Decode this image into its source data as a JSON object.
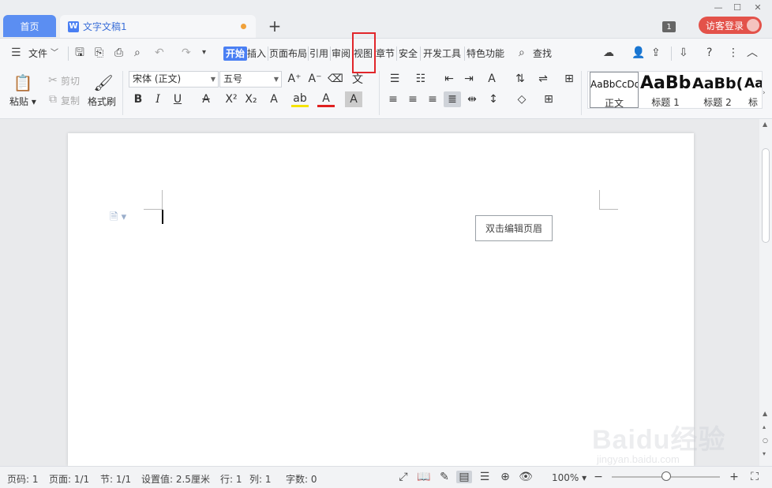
{
  "tabs": {
    "home": "首页",
    "doc_title": "文字文稿1",
    "add": "+"
  },
  "titlebar": {
    "badge": "1",
    "login": "访客登录"
  },
  "menu": {
    "file": "文件",
    "items": [
      "开始",
      "插入",
      "页面布局",
      "引用",
      "审阅",
      "视图",
      "章节",
      "安全",
      "开发工具",
      "特色功能"
    ],
    "search": "查找"
  },
  "ribbon": {
    "paste": "粘贴",
    "cut": "剪切",
    "copy": "复制",
    "format_painter": "格式刷",
    "font_name": "宋体 (正文)",
    "font_size": "五号"
  },
  "styles": [
    {
      "sample": "AaBbCcDd",
      "label": "正文"
    },
    {
      "sample": "AaBb",
      "label": "标题 1"
    },
    {
      "sample": "AaBb(",
      "label": "标题 2"
    },
    {
      "sample": "Aa",
      "label": "标"
    }
  ],
  "document": {
    "header_hint": "双击编辑页眉"
  },
  "status": {
    "page_num": "页码: 1",
    "pages": "页面: 1/1",
    "section": "节: 1/1",
    "setting": "设置值: 2.5厘米",
    "row": "行: 1",
    "col": "列: 1",
    "words": "字数: 0",
    "zoom": "100%"
  },
  "zoom_level": 1.0,
  "watermark": {
    "brand": "Baidu经验",
    "url": "jingyan.baidu.com"
  },
  "colors": {
    "accent": "#4a7ff3",
    "login_bg": "#e3524a",
    "highlight_box": "#e1262b"
  }
}
